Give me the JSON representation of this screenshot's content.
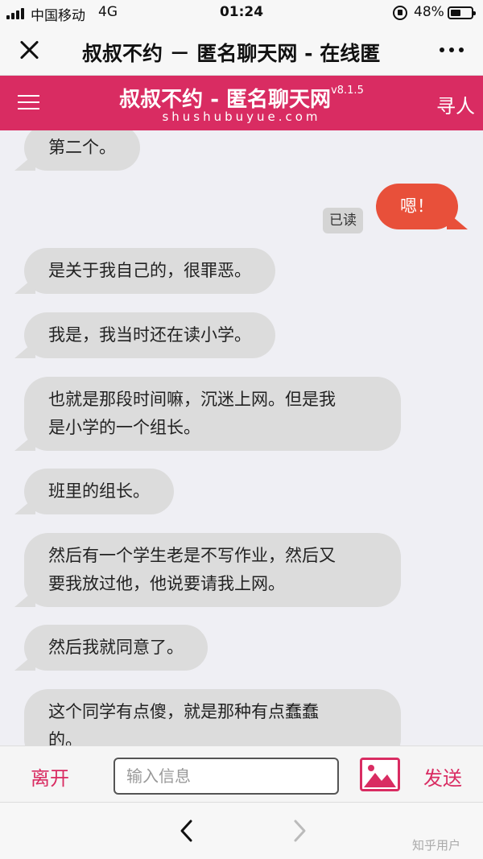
{
  "status_bar": {
    "carrier": "中国移动",
    "network": "4G",
    "time": "01:24",
    "battery": "48%",
    "battery_level": 0.48
  },
  "browser": {
    "page_title": "叔叔不约 － 匿名聊天网 - 在线匿"
  },
  "site": {
    "name": "叔叔不约 - 匿名聊天网",
    "version": "v8.1.5",
    "domain": "shushubuyue.com",
    "find_label": "寻人",
    "brand_color": "#d92c62"
  },
  "messages": [
    {
      "side": "in",
      "text": "第二个。"
    },
    {
      "side": "out",
      "text": "嗯！"
    },
    {
      "side": "in",
      "text": "是关于我自己的，很罪恶。"
    },
    {
      "side": "in",
      "text": "我是，我当时还在读小学。"
    },
    {
      "side": "in",
      "text": "也就是那段时间嘛，沉迷上网。但是我\n是小学的一个组长。"
    },
    {
      "side": "in",
      "text": "班里的组长。"
    },
    {
      "side": "in",
      "text": "然后有一个学生老是不写作业，然后又\n要我放过他，他说要请我上网。"
    },
    {
      "side": "in",
      "text": "然后我就同意了。"
    },
    {
      "side": "in",
      "text": "这个同学有点傻，就是那种有点蠢蠢\n的。"
    }
  ],
  "read_receipt": "已读",
  "composer": {
    "leave_label": "离开",
    "input_placeholder": "输入信息",
    "send_label": "发送",
    "image_icon": "image-icon"
  },
  "bottom_nav": {
    "back_icon": "chevron-left-icon",
    "forward_icon": "chevron-right-icon",
    "watermark": "知乎用户"
  }
}
